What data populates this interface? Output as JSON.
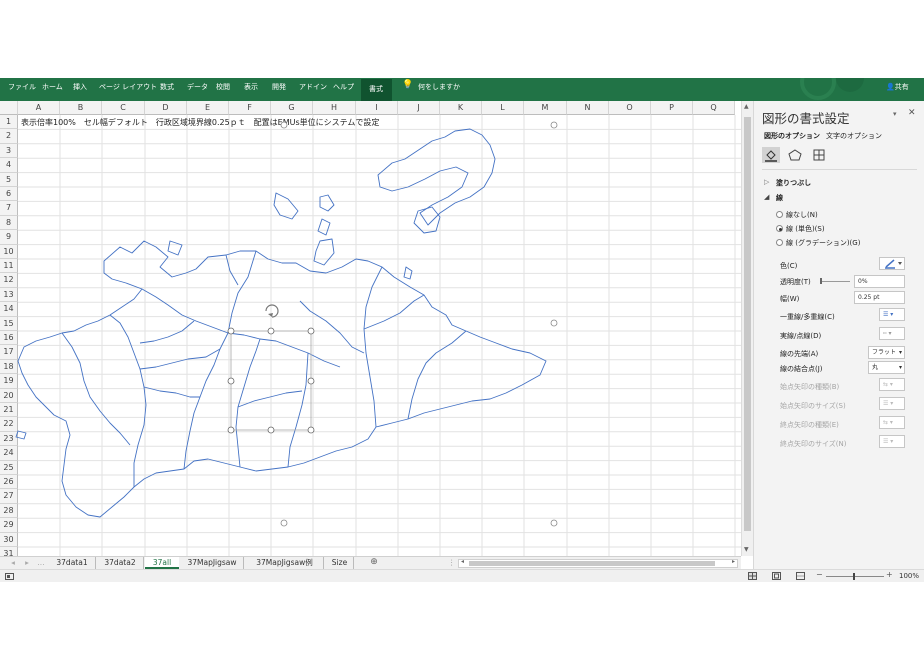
{
  "ribbon": {
    "tabs": [
      "ファイル",
      "ホーム",
      "挿入",
      "ページ レイアウト",
      "数式",
      "データ",
      "校閲",
      "表示",
      "開発",
      "アドイン",
      "ヘルプ",
      "書式"
    ],
    "tell_me": "何をしますか",
    "share": "共有"
  },
  "grid": {
    "columns": [
      "A",
      "B",
      "C",
      "D",
      "E",
      "F",
      "G",
      "H",
      "I",
      "J",
      "K",
      "L",
      "M",
      "N",
      "O",
      "P",
      "Q"
    ],
    "rows": [
      "1",
      "2",
      "3",
      "4",
      "5",
      "6",
      "7",
      "8",
      "9",
      "10",
      "11",
      "12",
      "13",
      "14",
      "15",
      "16",
      "17",
      "18",
      "19",
      "20",
      "21",
      "22",
      "23",
      "24",
      "25",
      "26",
      "27",
      "28",
      "29",
      "30",
      "31"
    ],
    "cell_a1": "表示倍率100%　セル幅デフォルト　行政区域境界線0.25ｐｔ　配置はEMUs単位にシステムで設定"
  },
  "pane": {
    "title": "図形の書式設定",
    "tab_shape": "図形のオプション",
    "tab_text": "文字のオプション",
    "fill_section": "塗りつぶし",
    "line_section": "線",
    "no_line": "線なし(N)",
    "solid_line": "線 (単色)(S)",
    "gradient_line": "線 (グラデーション)(G)",
    "color": "色(C)",
    "transparency": "透明度(T)",
    "transparency_value": "0%",
    "width": "幅(W)",
    "width_value": "0.25 pt",
    "compound": "一重線/多重線(C)",
    "dash": "実線/点線(D)",
    "cap": "線の先端(A)",
    "cap_value": "フラット",
    "join": "線の結合点(J)",
    "join_value": "丸",
    "begin_arrow_type": "始点矢印の種類(B)",
    "begin_arrow_size": "始点矢印のサイズ(S)",
    "end_arrow_type": "終点矢印の種類(E)",
    "end_arrow_size": "終点矢印のサイズ(N)"
  },
  "sheets": {
    "tabs": [
      "37data1",
      "37data2",
      "37all",
      "37MapJigsaw",
      "37MapJigsaw例",
      "Size"
    ],
    "active": "37all",
    "more": "..."
  },
  "status": {
    "zoom": "100%"
  },
  "colors": {
    "ribbon": "#217346",
    "map_line": "#4472c4",
    "active_sheet": "#217346"
  }
}
